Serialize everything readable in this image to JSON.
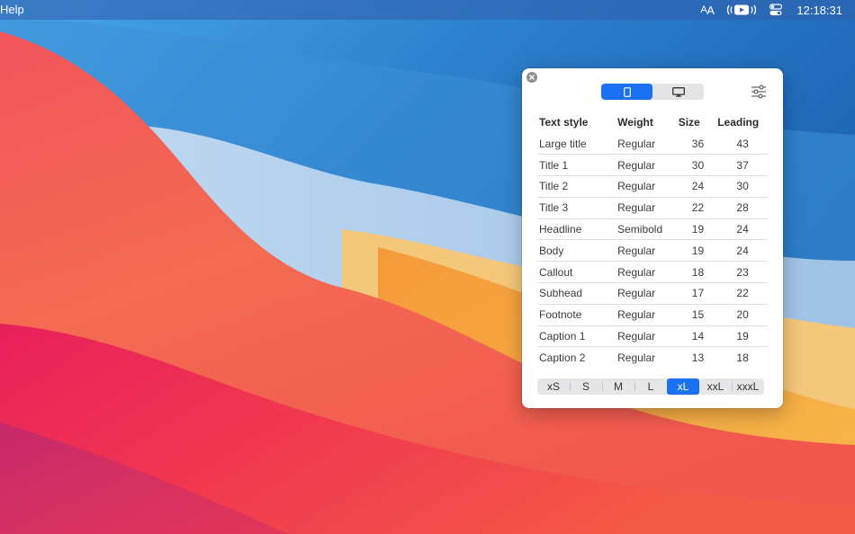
{
  "menubar": {
    "app_menu": "Help",
    "font_icon": "text-size-icon",
    "clock": "12:18:31"
  },
  "panel": {
    "device_tabs": [
      {
        "icon": "iphone-icon",
        "active": true
      },
      {
        "icon": "desktop-icon",
        "active": false
      }
    ],
    "headers": {
      "style": "Text style",
      "weight": "Weight",
      "size": "Size",
      "leading": "Leading"
    },
    "rows": [
      {
        "style": "Large title",
        "weight": "Regular",
        "size": "36",
        "leading": "43"
      },
      {
        "style": "Title 1",
        "weight": "Regular",
        "size": "30",
        "leading": "37"
      },
      {
        "style": "Title 2",
        "weight": "Regular",
        "size": "24",
        "leading": "30"
      },
      {
        "style": "Title 3",
        "weight": "Regular",
        "size": "22",
        "leading": "28"
      },
      {
        "style": "Headline",
        "weight": "Semibold",
        "size": "19",
        "leading": "24"
      },
      {
        "style": "Body",
        "weight": "Regular",
        "size": "19",
        "leading": "24"
      },
      {
        "style": "Callout",
        "weight": "Regular",
        "size": "18",
        "leading": "23"
      },
      {
        "style": "Subhead",
        "weight": "Regular",
        "size": "17",
        "leading": "22"
      },
      {
        "style": "Footnote",
        "weight": "Regular",
        "size": "15",
        "leading": "20"
      },
      {
        "style": "Caption 1",
        "weight": "Regular",
        "size": "14",
        "leading": "19"
      },
      {
        "style": "Caption 2",
        "weight": "Regular",
        "size": "13",
        "leading": "18"
      }
    ],
    "size_options": [
      "xS",
      "S",
      "M",
      "L",
      "xL",
      "xxL",
      "xxxL"
    ],
    "selected_size": "xL"
  },
  "colors": {
    "accent": "#1a72f2",
    "panel_bg": "#ffffff"
  }
}
